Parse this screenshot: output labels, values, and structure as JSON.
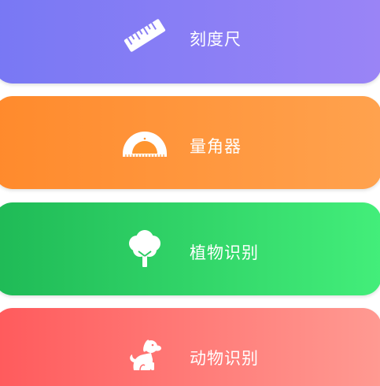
{
  "tools": [
    {
      "label": "刻度尺",
      "icon": "ruler-icon",
      "color_start": "#7878f4",
      "color_end": "#9a84f6"
    },
    {
      "label": "量角器",
      "icon": "protractor-icon",
      "color_start": "#ff8a2c",
      "color_end": "#ffa24e"
    },
    {
      "label": "植物识别",
      "icon": "tree-icon",
      "color_start": "#1fba56",
      "color_end": "#43ee7a"
    },
    {
      "label": "动物识别",
      "icon": "dog-icon",
      "color_start": "#ff5a5c",
      "color_end": "#ff9a92"
    }
  ]
}
